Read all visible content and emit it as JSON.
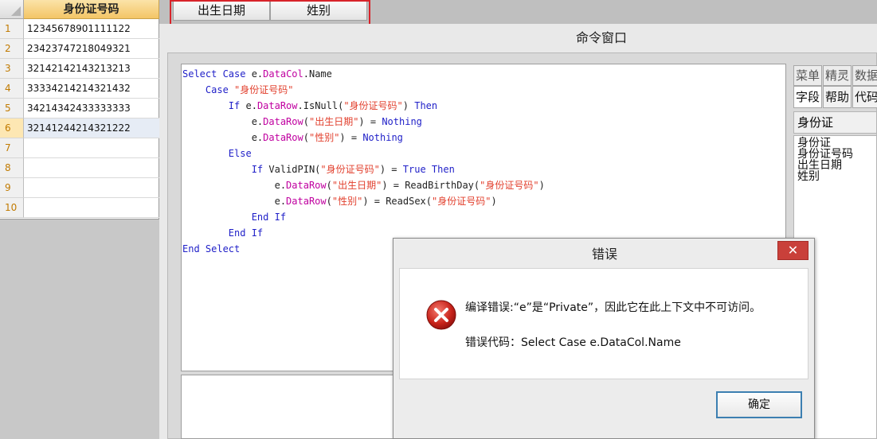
{
  "grid": {
    "column_header": "身份证号码",
    "rows": [
      {
        "num": "1",
        "value": "12345678901111122"
      },
      {
        "num": "2",
        "value": "23423747218049321"
      },
      {
        "num": "3",
        "value": "32142142143213213"
      },
      {
        "num": "4",
        "value": "33334214214321432"
      },
      {
        "num": "5",
        "value": "34214342433333333"
      },
      {
        "num": "6",
        "value": "32141244214321222"
      },
      {
        "num": "7",
        "value": ""
      },
      {
        "num": "8",
        "value": ""
      },
      {
        "num": "9",
        "value": ""
      },
      {
        "num": "10",
        "value": ""
      }
    ]
  },
  "tabs": {
    "birth": "出生日期",
    "sex": "姓别"
  },
  "command_window": {
    "title": "命令窗口"
  },
  "helper": {
    "tabs_row1": [
      "菜单",
      "精灵",
      "数据"
    ],
    "tabs_row2": [
      "字段",
      "帮助",
      "代码"
    ],
    "selected_field": "身份证",
    "fields": [
      "身份证",
      "身份证号码",
      "出生日期",
      "姓别"
    ]
  },
  "dialog": {
    "title": "错误",
    "close": "✕",
    "message": "编译错误:“e”是“Private”，因此它在此上下文中不可访问。",
    "code_line": "错误代码：Select Case e.DataCol.Name",
    "ok": "确定"
  },
  "colors": {
    "keyword": "#1f1fc8",
    "string": "#e2402e",
    "property": "#c000a0",
    "highlight_box": "#d8232a",
    "close_button": "#c9403a"
  }
}
